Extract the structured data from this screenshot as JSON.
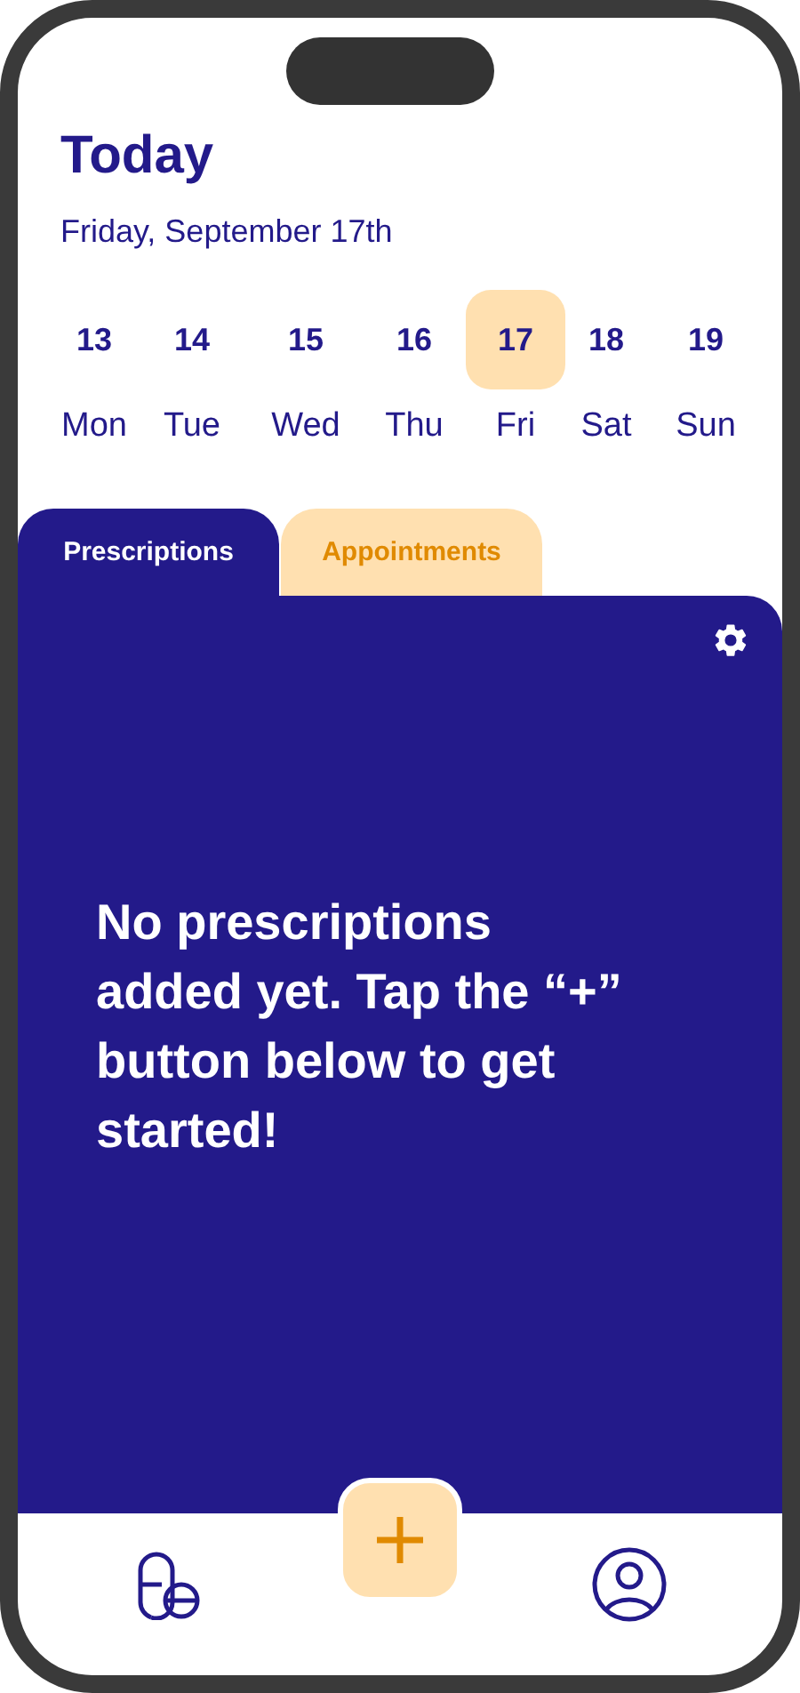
{
  "header": {
    "title": "Today",
    "date": "Friday, September 17th"
  },
  "days": [
    {
      "number": "13",
      "name": "Mon",
      "selected": false
    },
    {
      "number": "14",
      "name": "Tue",
      "selected": false
    },
    {
      "number": "15",
      "name": "Wed",
      "selected": false
    },
    {
      "number": "16",
      "name": "Thu",
      "selected": false
    },
    {
      "number": "17",
      "name": "Fri",
      "selected": true
    },
    {
      "number": "18",
      "name": "Sat",
      "selected": false
    },
    {
      "number": "19",
      "name": "Sun",
      "selected": false
    }
  ],
  "tabs": [
    {
      "label": "Prescriptions",
      "selected": true
    },
    {
      "label": "Appointments",
      "selected": false
    }
  ],
  "panel": {
    "message": "No prescriptions added yet. Tap the “+” button below to get started!"
  }
}
